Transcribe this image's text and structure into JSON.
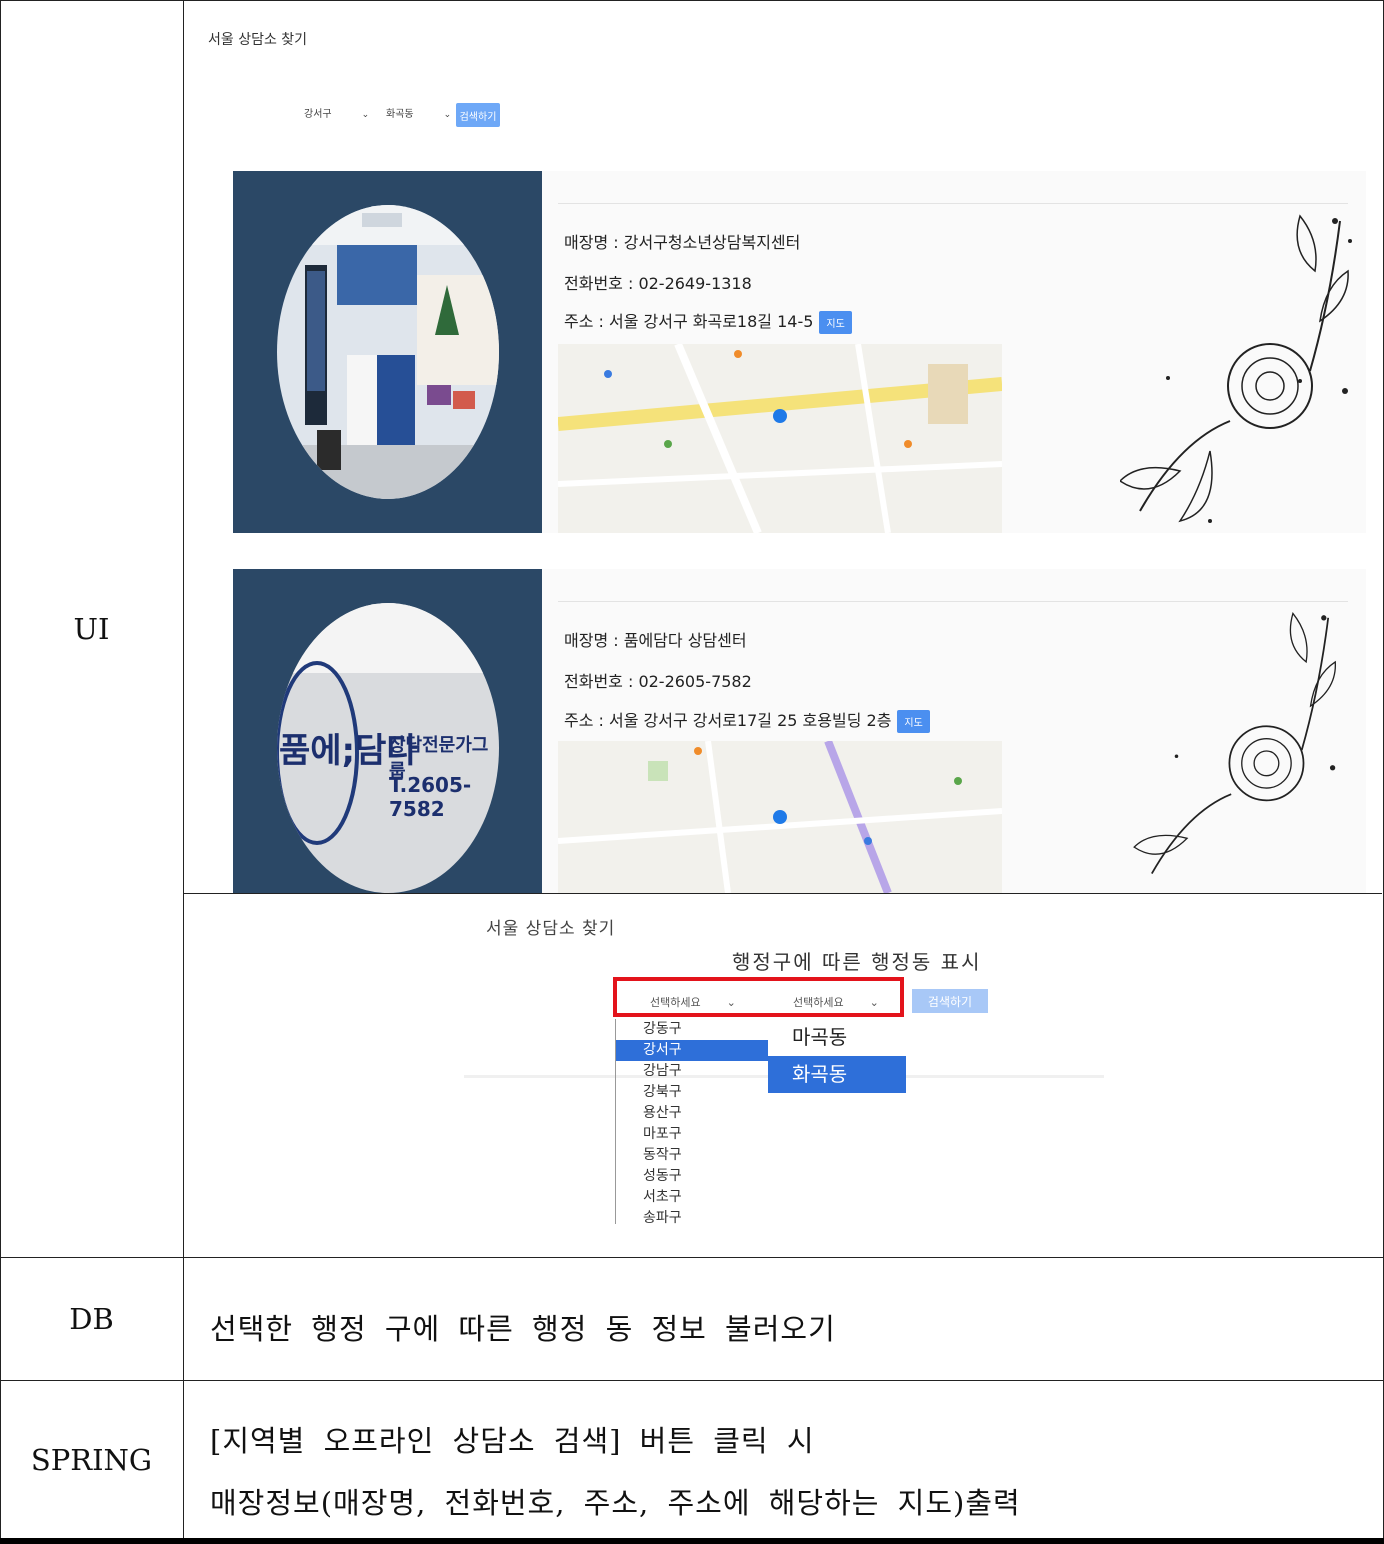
{
  "labels": {
    "ui": "UI",
    "db": "DB",
    "spring": "SPRING"
  },
  "ui_top": {
    "title": "서울 상담소 찾기",
    "district_select": "강서구",
    "dong_select": "화곡동",
    "search_button": "검색하기",
    "cards": [
      {
        "name": "매장명 : 강서구청소년상담복지센터",
        "phone": "전화번호 : 02-2649-1318",
        "address": "주소 : 서울 강서구 화곡로18길 14-5",
        "map_button": "지도"
      },
      {
        "name": "매장명 : 품에담다 상담센터",
        "phone": "전화번호 : 02-2605-7582",
        "address": "주소 : 서울 강서구 강서로17길 25 호용빌딩 2층",
        "map_button": "지도",
        "sign_main": "품에;담다",
        "sign_sub": "상담전문가그룹",
        "sign_phone": "T.2605-7582"
      }
    ]
  },
  "ui_bottom": {
    "title": "서울 상담소 찾기",
    "subtitle": "행정구에 따른 행정동 표시",
    "select_placeholder_1": "선택하세요",
    "select_placeholder_2": "선택하세요",
    "search_button": "검색하기",
    "districts": [
      "강동구",
      "강서구",
      "강남구",
      "강북구",
      "용산구",
      "마포구",
      "동작구",
      "성동구",
      "서초구",
      "송파구"
    ],
    "selected_district_index": 1,
    "dongs": [
      "마곡동",
      "화곡동"
    ],
    "selected_dong_index": 1
  },
  "db_text": "선택한 행정 구에 따른 행정 동 정보 불러오기",
  "spring_text_1": "[지역별 오프라인 상담소 검색] 버튼 클릭 시",
  "spring_text_2": "매장정보(매장명, 전화번호, 주소, 주소에 해당하는 지도)출력"
}
